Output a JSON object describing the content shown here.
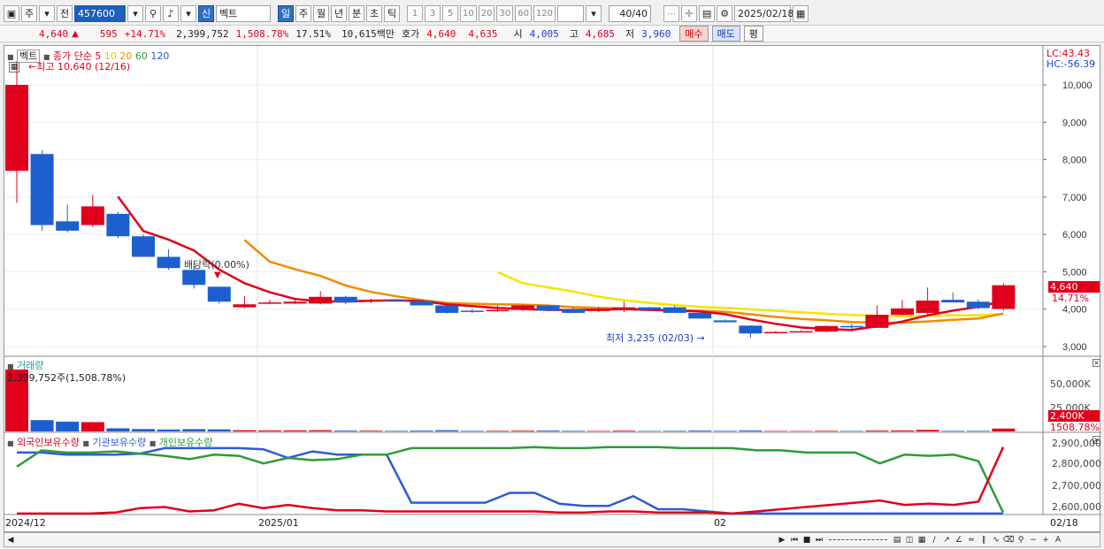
{
  "toolbar": {
    "market": "주",
    "prev": "전",
    "code": "457600",
    "type_badge": "신",
    "name": "벡트",
    "periods": [
      "일",
      "주",
      "월",
      "년",
      "분",
      "초",
      "틱"
    ],
    "numbers": [
      "1",
      "3",
      "5",
      "10",
      "20",
      "30",
      "60",
      "120"
    ],
    "count": "40/40",
    "date": "2025/02/18"
  },
  "quote": {
    "price": "4,640",
    "change": "595",
    "change_pct": "+14.71%",
    "volume": "2,399,752",
    "volume_pct": "1,508.78%",
    "turnover_pct": "17.51%",
    "amount": "10,615백만",
    "ask_label": "호가",
    "ask1": "4,640",
    "ask2": "4,635",
    "open_label": "시",
    "open": "4,005",
    "high_label": "고",
    "high": "4,685",
    "low_label": "저",
    "low": "3,960",
    "buy": "매수",
    "sell": "매도",
    "eval": "평"
  },
  "legend": {
    "name": "벡트",
    "ma_title": "종가 단순",
    "ma": [
      {
        "period": "5",
        "color": "#e0001b"
      },
      {
        "period": "10",
        "color": "#f5e400"
      },
      {
        "period": "20",
        "color": "#f08b00"
      },
      {
        "period": "60",
        "color": "#2e9a3a"
      },
      {
        "period": "120",
        "color": "#2c5bd6"
      }
    ]
  },
  "annotations": {
    "max": "최고 10,640 (12/16)",
    "min": "최저 3,235 (02/03)",
    "dividend": "배당락(0.00%)",
    "lc": "LC:43.43",
    "hc": "HC:-56.39",
    "last_price": "4,640",
    "last_pct": "14.71%"
  },
  "volume_panel": {
    "title": "거래량",
    "info": "2,399,752주(1,508.78%)",
    "axis": [
      "50,000K",
      "25,000K"
    ],
    "last": "2,400K",
    "last_pct": "1508.78%"
  },
  "holdings_panel": {
    "foreign": "외국인보유수량",
    "institution": "기관보유수량",
    "individual": "개인보유수량",
    "axis": [
      "2,900,000",
      "2,800,000",
      "2,700,000",
      "2,600,000"
    ]
  },
  "x_labels": [
    "2024/12",
    "2025/01",
    "02",
    "02/18"
  ],
  "chart_data": {
    "type": "candlestick",
    "y_ticks": [
      3000,
      4000,
      5000,
      6000,
      7000,
      8000,
      9000,
      10000
    ],
    "candles": [
      {
        "o": 7700,
        "h": 10640,
        "l": 6850,
        "c": 10000
      },
      {
        "o": 8150,
        "h": 8250,
        "l": 6100,
        "c": 6250
      },
      {
        "o": 6350,
        "h": 6800,
        "l": 6050,
        "c": 6100
      },
      {
        "o": 6250,
        "h": 7050,
        "l": 6200,
        "c": 6750
      },
      {
        "o": 6550,
        "h": 6600,
        "l": 5900,
        "c": 5950
      },
      {
        "o": 5950,
        "h": 6000,
        "l": 5400,
        "c": 5400
      },
      {
        "o": 5400,
        "h": 5600,
        "l": 5050,
        "c": 5100
      },
      {
        "o": 5050,
        "h": 5200,
        "l": 4550,
        "c": 4650
      },
      {
        "o": 4600,
        "h": 4600,
        "l": 4150,
        "c": 4200
      },
      {
        "o": 4050,
        "h": 4350,
        "l": 4020,
        "c": 4130
      },
      {
        "o": 4150,
        "h": 4250,
        "l": 4130,
        "c": 4180
      },
      {
        "o": 4150,
        "h": 4300,
        "l": 4140,
        "c": 4200
      },
      {
        "o": 4150,
        "h": 4480,
        "l": 4130,
        "c": 4330
      },
      {
        "o": 4330,
        "h": 4360,
        "l": 4130,
        "c": 4180
      },
      {
        "o": 4230,
        "h": 4280,
        "l": 4160,
        "c": 4250
      },
      {
        "o": 4240,
        "h": 4260,
        "l": 4200,
        "c": 4220
      },
      {
        "o": 4220,
        "h": 4230,
        "l": 4100,
        "c": 4100
      },
      {
        "o": 4100,
        "h": 4110,
        "l": 3880,
        "c": 3900
      },
      {
        "o": 3960,
        "h": 4000,
        "l": 3900,
        "c": 3950
      },
      {
        "o": 3950,
        "h": 4100,
        "l": 3930,
        "c": 3980
      },
      {
        "o": 3980,
        "h": 4120,
        "l": 3950,
        "c": 4100
      },
      {
        "o": 4100,
        "h": 4120,
        "l": 3950,
        "c": 3960
      },
      {
        "o": 4000,
        "h": 4050,
        "l": 3890,
        "c": 3900
      },
      {
        "o": 3950,
        "h": 4050,
        "l": 3920,
        "c": 4000
      },
      {
        "o": 4000,
        "h": 4200,
        "l": 3920,
        "c": 4050
      },
      {
        "o": 4050,
        "h": 4060,
        "l": 3950,
        "c": 3980
      },
      {
        "o": 4050,
        "h": 4100,
        "l": 3900,
        "c": 3900
      },
      {
        "o": 3900,
        "h": 3920,
        "l": 3750,
        "c": 3750
      },
      {
        "o": 3700,
        "h": 3730,
        "l": 3650,
        "c": 3650
      },
      {
        "o": 3560,
        "h": 3570,
        "l": 3235,
        "c": 3350
      },
      {
        "o": 3380,
        "h": 3420,
        "l": 3360,
        "c": 3390
      },
      {
        "o": 3400,
        "h": 3430,
        "l": 3380,
        "c": 3410
      },
      {
        "o": 3400,
        "h": 3560,
        "l": 3380,
        "c": 3550
      },
      {
        "o": 3550,
        "h": 3600,
        "l": 3470,
        "c": 3520
      },
      {
        "o": 3500,
        "h": 4100,
        "l": 3500,
        "c": 3850
      },
      {
        "o": 3850,
        "h": 4250,
        "l": 3830,
        "c": 4020
      },
      {
        "o": 3900,
        "h": 4580,
        "l": 3850,
        "c": 4230
      },
      {
        "o": 4250,
        "h": 4450,
        "l": 4200,
        "c": 4180
      },
      {
        "o": 4200,
        "h": 4260,
        "l": 4000,
        "c": 4030
      },
      {
        "o": 4005,
        "h": 4685,
        "l": 3960,
        "c": 4640
      }
    ],
    "volume_k": [
      52000,
      9500,
      8200,
      7800,
      2600,
      2000,
      1600,
      1900,
      1700,
      1000,
      800,
      900,
      1000,
      700,
      600,
      500,
      700,
      1000,
      500,
      500,
      600,
      700,
      500,
      400,
      600,
      400,
      500,
      700,
      500,
      800,
      400,
      350,
      500,
      400,
      700,
      800,
      1300,
      500,
      500,
      2400
    ],
    "holdings": {
      "foreign": [
        2580000,
        2580000,
        2580000,
        2580000,
        2585000,
        2605000,
        2610000,
        2590000,
        2595000,
        2625000,
        2605000,
        2620000,
        2605000,
        2595000,
        2595000,
        2590000,
        2590000,
        2590000,
        2590000,
        2590000,
        2590000,
        2590000,
        2585000,
        2585000,
        2590000,
        2590000,
        2585000,
        2585000,
        2585000,
        2580000,
        2590000,
        2600000,
        2610000,
        2620000,
        2630000,
        2640000,
        2620000,
        2625000,
        2620000,
        2635000,
        2885000
      ],
      "institution": [
        2860000,
        2860000,
        2850000,
        2850000,
        2850000,
        2855000,
        2880000,
        2880000,
        2880000,
        2880000,
        2875000,
        2835000,
        2865000,
        2850000,
        2850000,
        2850000,
        2630000,
        2630000,
        2630000,
        2630000,
        2675000,
        2675000,
        2625000,
        2615000,
        2615000,
        2660000,
        2600000,
        2600000,
        2590000,
        2580000,
        2580000,
        2580000,
        2580000,
        2580000,
        2580000,
        2580000,
        2580000,
        2580000,
        2580000,
        2580000,
        2580000
      ],
      "individual": [
        2795000,
        2870000,
        2860000,
        2860000,
        2865000,
        2855000,
        2845000,
        2830000,
        2850000,
        2845000,
        2810000,
        2835000,
        2825000,
        2830000,
        2850000,
        2850000,
        2880000,
        2880000,
        2880000,
        2880000,
        2880000,
        2885000,
        2880000,
        2880000,
        2885000,
        2885000,
        2885000,
        2880000,
        2880000,
        2880000,
        2870000,
        2870000,
        2860000,
        2860000,
        2860000,
        2810000,
        2850000,
        2845000,
        2850000,
        2820000,
        2585000
      ]
    }
  }
}
